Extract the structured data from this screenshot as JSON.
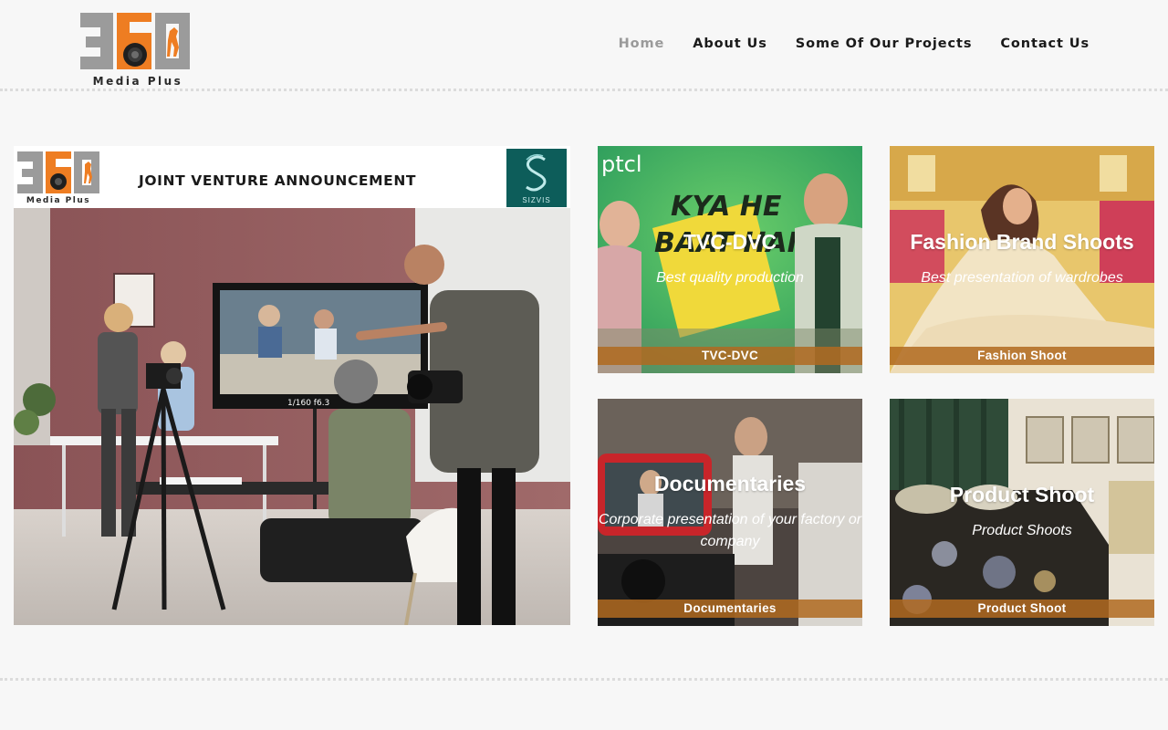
{
  "brand": {
    "logo_number": "360",
    "logo_wordmark": "Media Plus",
    "colors": {
      "gray": "#9b9b9b",
      "orange": "#ee7d22",
      "dark": "#2a2a2a"
    }
  },
  "nav": {
    "items": [
      {
        "label": "Home",
        "active": true
      },
      {
        "label": "About Us",
        "active": false
      },
      {
        "label": "Some Of Our Projects",
        "active": false
      },
      {
        "label": "Contact Us",
        "active": false
      }
    ]
  },
  "feature": {
    "heading": "JOINT VENTURE ANNOUNCEMENT",
    "partner_logo": "SIZVIS",
    "monitor_readout": "1/160  f6.3"
  },
  "cards": [
    {
      "title": "TVC-DVC",
      "subtitle": "Best quality production",
      "bar": "TVC-DVC",
      "art_text": {
        "brand": "ptcl",
        "line1": "KYA HE",
        "line2": "BAAT HAI"
      }
    },
    {
      "title": "Fashion Brand Shoots",
      "subtitle": "Best presentation of wardrobes",
      "bar": "Fashion Shoot"
    },
    {
      "title": "Documentaries",
      "subtitle": "Corporate presentation of your factory or company",
      "bar": "Documentaries"
    },
    {
      "title": "Product Shoot",
      "subtitle": "Product Shoots",
      "bar": "Product Shoot"
    }
  ]
}
